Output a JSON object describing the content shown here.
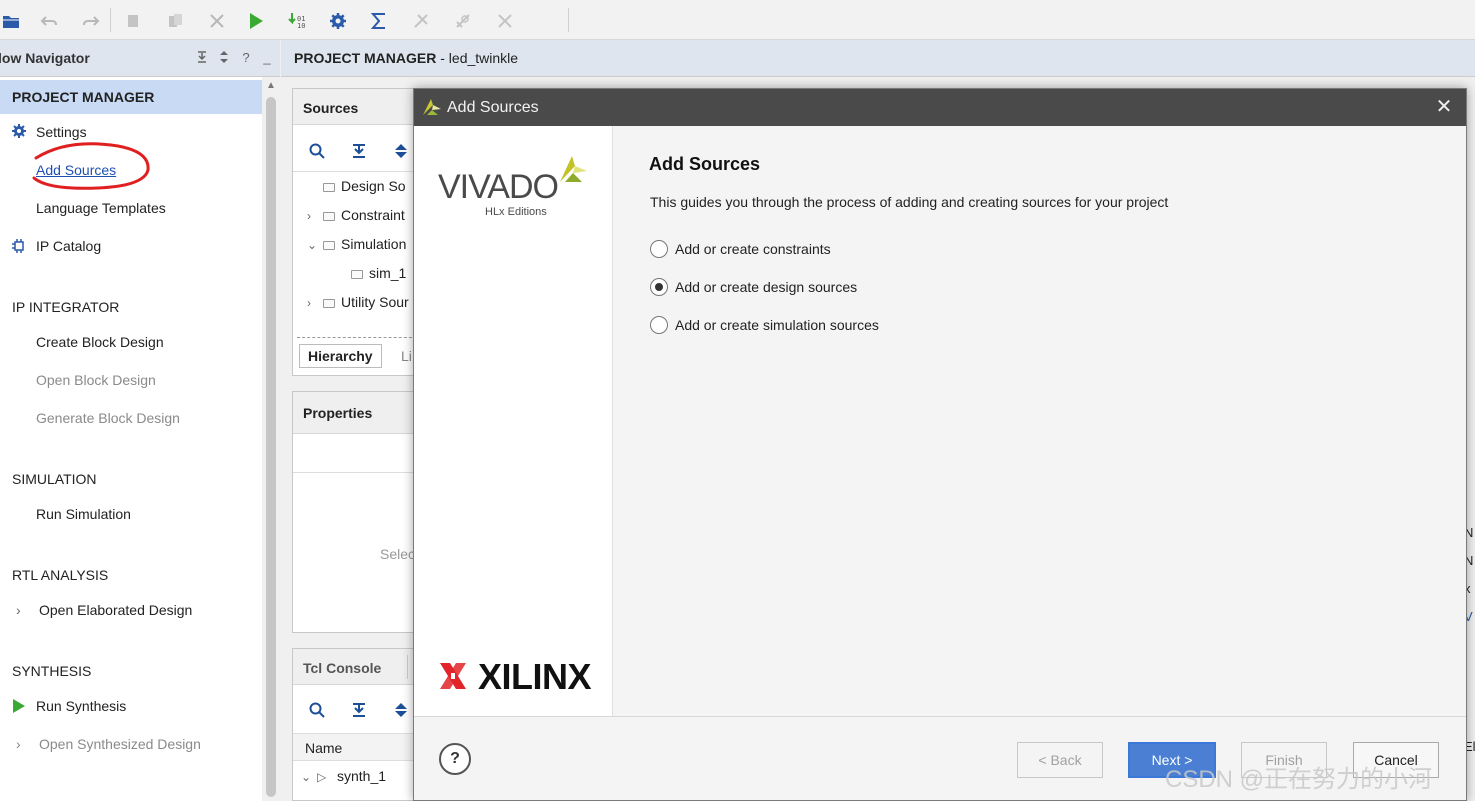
{
  "toolbar": {
    "icons": [
      "open-project-icon",
      "undo-icon",
      "redo-icon",
      "copy-icon",
      "paste-icon",
      "delete-icon",
      "run-icon",
      "program-icon",
      "settings-icon",
      "sigma-icon",
      "disabled-icon-1",
      "disabled-icon-2",
      "disabled-icon-3"
    ],
    "colors": {
      "run": "#3aaa35",
      "accent": "#2a5aa8"
    }
  },
  "flow_nav": {
    "title": "low Navigator",
    "header_buttons": [
      "collapse-all-icon",
      "sort-icon",
      "help-icon",
      "minimize-icon"
    ],
    "header_glyphs": {
      "help": "?",
      "minimize": "_"
    },
    "project_manager": {
      "title": "PROJECT MANAGER",
      "items": [
        {
          "label": "Settings"
        },
        {
          "label": "Add Sources"
        },
        {
          "label": "Language Templates"
        },
        {
          "label": "IP Catalog"
        }
      ]
    },
    "ip_integrator": {
      "title": "IP INTEGRATOR",
      "items": [
        {
          "label": "Create Block Design"
        },
        {
          "label": "Open Block Design"
        },
        {
          "label": "Generate Block Design"
        }
      ]
    },
    "simulation": {
      "title": "SIMULATION",
      "items": [
        {
          "label": "Run Simulation"
        }
      ]
    },
    "rtl_analysis": {
      "title": "RTL ANALYSIS",
      "items": [
        {
          "label": "Open Elaborated Design"
        }
      ]
    },
    "synthesis": {
      "title": "SYNTHESIS",
      "items": [
        {
          "label": "Run Synthesis"
        },
        {
          "label": "Open Synthesized Design"
        }
      ]
    }
  },
  "main": {
    "header_bold": "PROJECT MANAGER",
    "header_rest": " - led_twinkle",
    "sources": {
      "title": "Sources",
      "tree": [
        {
          "label": "Design So"
        },
        {
          "label": "Constraint"
        },
        {
          "label": "Simulation"
        },
        {
          "label": "sim_1"
        },
        {
          "label": "Utility Sour"
        }
      ],
      "tabs": [
        "Hierarchy",
        "Li"
      ]
    },
    "properties": {
      "title": "Properties",
      "placeholder": "Selec"
    },
    "tcl": {
      "title": "Tcl Console",
      "column": "Name",
      "rows": [
        {
          "label": "synth_1"
        }
      ]
    },
    "right_strip": [
      "N",
      "N",
      "x",
      "V",
      "Ela"
    ]
  },
  "dialog": {
    "title": "Add Sources",
    "close_glyph": "✕",
    "brand_vivado": "VIVADO",
    "brand_sub": "HLx Editions",
    "brand_xilinx": "XILINX",
    "heading": "Add Sources",
    "description": "This guides you through the process of adding and creating sources for your project",
    "options": [
      {
        "label": "Add or create constraints",
        "checked": false
      },
      {
        "label": "Add or create design sources",
        "checked": true
      },
      {
        "label": "Add or create simulation sources",
        "checked": false
      }
    ],
    "buttons": {
      "help": "?",
      "back": "< Back",
      "next": "Next >",
      "finish": "Finish",
      "cancel": "Cancel"
    }
  },
  "watermark": "CSDN @正在努力的小河"
}
